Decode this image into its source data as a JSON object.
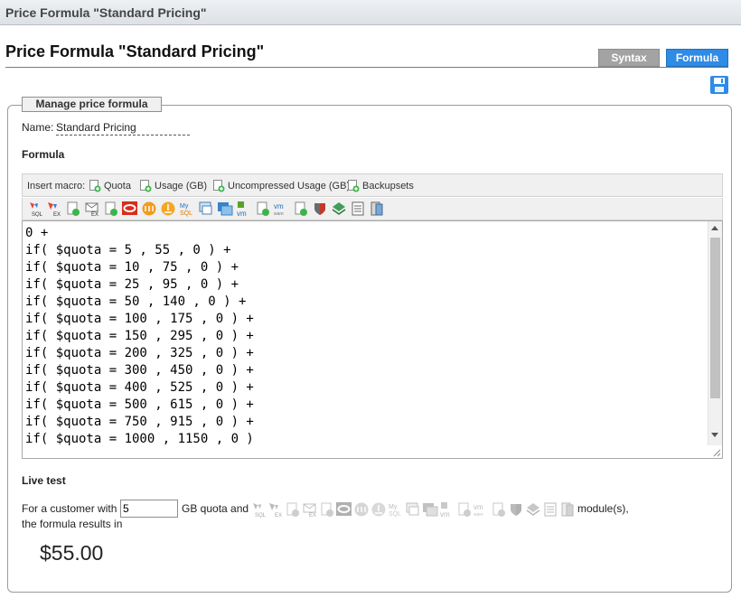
{
  "window": {
    "title": "Price Formula \"Standard Pricing\""
  },
  "header": {
    "title": "Price Formula \"Standard Pricing\""
  },
  "tabs": [
    {
      "label": "Syntax"
    },
    {
      "label": "Formula"
    }
  ],
  "colors": {
    "active_tab": "#2e8be6",
    "inactive_tab": "#a3a3a3",
    "save_icon": "#2e8be6"
  },
  "panel": {
    "legend": "Manage price formula",
    "name_label": "Name:",
    "name_value": "Standard Pricing",
    "formula_label": "Formula",
    "insert_macro_label": "Insert macro:",
    "macros": [
      "Quota",
      "Usage (GB)",
      "Uncompressed Usage (GB)",
      "Backupsets"
    ],
    "toolbar_icons": [
      "mssql-icon",
      "ms-exchange-icon",
      "generic-module-icon",
      "mail-exchange-icon",
      "generic-module-icon",
      "oracle-icon",
      "cyan-module-icon",
      "office365-icon",
      "mysql-icon",
      "system-state-icon",
      "hyperv-icon",
      "vmware-icon",
      "generic-module-icon",
      "vmware-label-icon",
      "generic-module-icon",
      "shield-icon",
      "layers-icon",
      "document-icon",
      "server-icon"
    ],
    "formula_lines": [
      "0 +",
      "if( $quota = 5 , 55 , 0 ) +",
      "if( $quota = 10 , 75 , 0 ) +",
      "if( $quota = 25 , 95 , 0 ) +",
      "if( $quota = 50 , 140 , 0 ) +",
      "if( $quota = 100 , 175 , 0 ) +",
      "if( $quota = 150 , 295 , 0 ) +",
      "if( $quota = 200 , 325 , 0 ) +",
      "if( $quota = 300 , 450 , 0 ) +",
      "if( $quota = 400 , 525 , 0 ) +",
      "if( $quota = 500 , 615 , 0 ) +",
      "if( $quota = 750 , 915 , 0 ) +",
      "if( $quota = 1000 , 1150 , 0 )"
    ]
  },
  "live_test": {
    "label": "Live test",
    "prefix": "For a customer with",
    "quota_value": "5",
    "middle": "GB quota and",
    "suffix": "module(s),",
    "result_prefix": "the formula results in",
    "result": "$55.00"
  }
}
